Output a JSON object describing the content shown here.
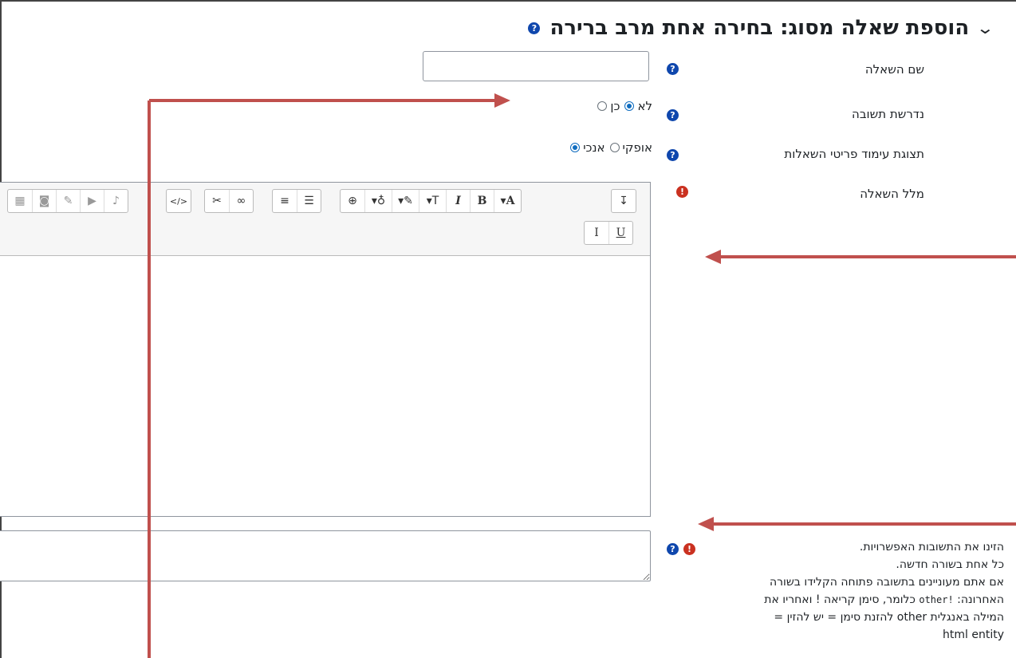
{
  "header": {
    "title": "הוספת שאלה מסוג: בחירה אחת מרב ברירה"
  },
  "fields": {
    "question_name": {
      "label": "שם השאלה",
      "value": "",
      "placeholder": ""
    },
    "answer_required": {
      "label": "נדרשת תשובה",
      "options": [
        {
          "label": "כן",
          "checked": false
        },
        {
          "label": "לא",
          "checked": true
        }
      ]
    },
    "display": {
      "label": "תצוגת עימוד פריטי השאלות",
      "options": [
        {
          "label": "אנכי",
          "checked": true
        },
        {
          "label": "אופקי",
          "checked": false
        }
      ]
    },
    "question_text": {
      "label": "מלל השאלה"
    }
  },
  "toolbar": {
    "row1": [
      {
        "icon": "show-more-icon",
        "glyph": "↧"
      },
      {
        "icon": "font-color-icon",
        "glyph": "▾A"
      },
      {
        "icon": "bold-icon",
        "glyph": "B"
      },
      {
        "icon": "italic-icon",
        "glyph": "I"
      },
      {
        "icon": "font-size-icon",
        "glyph": "▾T"
      },
      {
        "icon": "paint-brush-icon",
        "glyph": "▾✎"
      },
      {
        "icon": "lightbulb-icon",
        "glyph": "▾♁"
      },
      {
        "icon": "zoom-in-icon",
        "glyph": "⊕"
      },
      {
        "icon": "bullet-list-icon",
        "glyph": "☰"
      },
      {
        "icon": "numbered-list-icon",
        "glyph": "≡"
      },
      {
        "icon": "link-icon",
        "glyph": "∞"
      },
      {
        "icon": "unlink-icon",
        "glyph": "✂"
      },
      {
        "icon": "html-source-icon",
        "glyph": "</>"
      },
      {
        "icon": "microphone-icon",
        "glyph": "♪"
      },
      {
        "icon": "video-recording-icon",
        "glyph": "▶"
      },
      {
        "icon": "pencil-icon",
        "glyph": "✎"
      },
      {
        "icon": "camera-icon",
        "glyph": "◙"
      },
      {
        "icon": "table-icon",
        "glyph": "▦"
      }
    ],
    "row2": [
      {
        "icon": "underline-icon",
        "glyph": "U"
      },
      {
        "icon": "clear-formatting-icon",
        "glyph": "I"
      }
    ]
  },
  "answers_help": {
    "line1": "הזינו את התשובות האפשרויות.",
    "line2": "כל אחת בשורה חדשה.",
    "line3": "אם אתם מעוניינים בתשובה פתוחה הקלידו בשורה",
    "line4_pre": "האחרונה: ",
    "line4_code": "!other",
    "line4_post": " כלומר, סימן קריאה ! ואחריו את",
    "line5": "המילה באנגלית other להזנת סימן = יש להזין =",
    "line6": "html entity"
  },
  "colors": {
    "accent": "#0f6cbf",
    "help": "#0f47ad",
    "required": "#ca3120",
    "annotation_arrow": "#c0504d"
  }
}
